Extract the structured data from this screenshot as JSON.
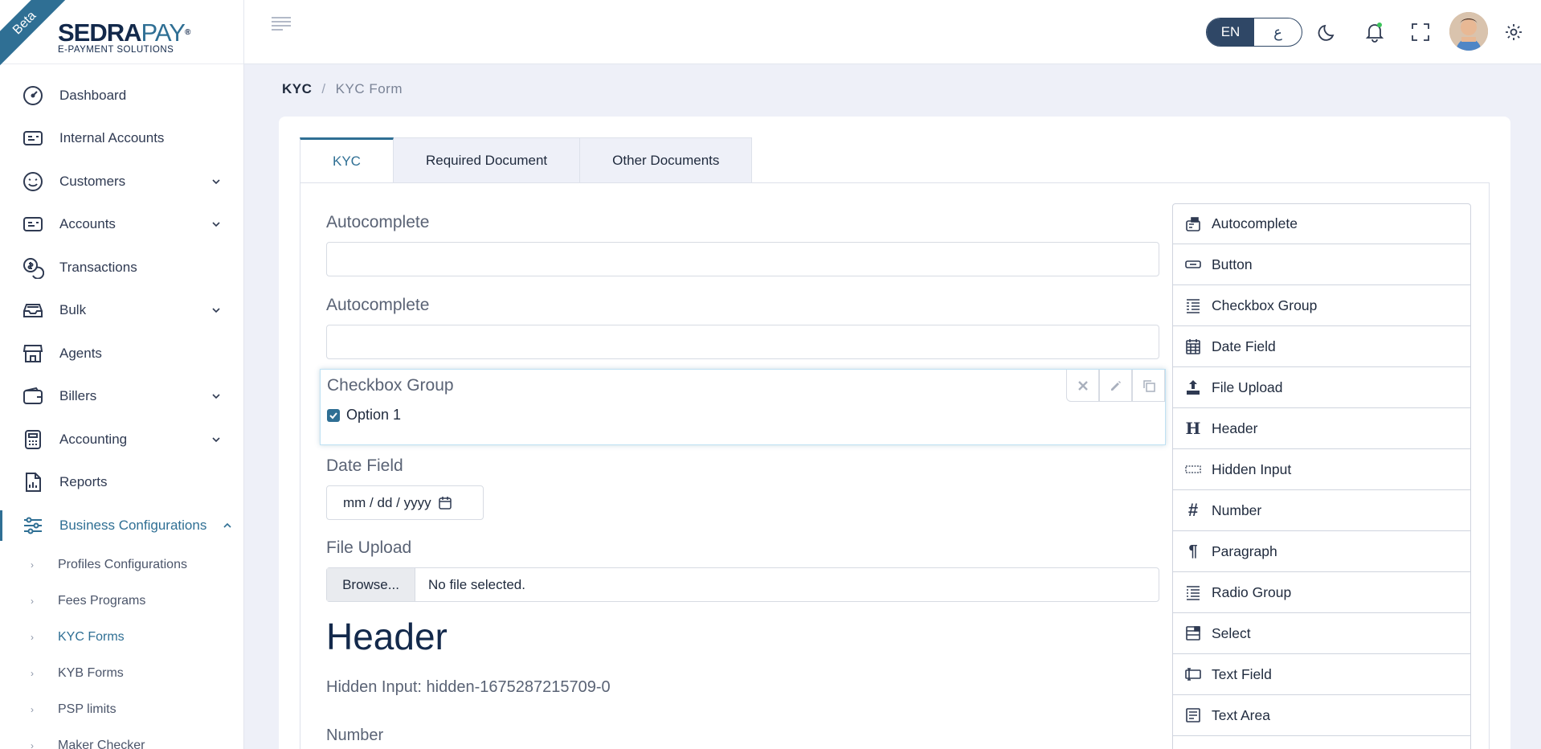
{
  "brand": {
    "beta": "Beta",
    "name_part1": "SEDRA",
    "name_part2": "PAY",
    "reg": "®",
    "tagline": "E-PAYMENT SOLUTIONS"
  },
  "sidebar": {
    "items": [
      {
        "label": "Dashboard",
        "icon": "speedometer-icon"
      },
      {
        "label": "Internal Accounts",
        "icon": "id-card-icon"
      },
      {
        "label": "Customers",
        "icon": "smiley-icon",
        "expandable": true
      },
      {
        "label": "Accounts",
        "icon": "id-card-icon",
        "expandable": true
      },
      {
        "label": "Transactions",
        "icon": "coins-icon"
      },
      {
        "label": "Bulk",
        "icon": "inbox-icon",
        "expandable": true
      },
      {
        "label": "Agents",
        "icon": "store-icon"
      },
      {
        "label": "Billers",
        "icon": "wallet-icon",
        "expandable": true
      },
      {
        "label": "Accounting",
        "icon": "calculator-icon",
        "expandable": true
      },
      {
        "label": "Reports",
        "icon": "report-icon"
      },
      {
        "label": "Business Configurations",
        "icon": "sliders-icon",
        "expanded": true
      }
    ],
    "sub_items": [
      {
        "label": "Profiles Configurations"
      },
      {
        "label": "Fees Programs"
      },
      {
        "label": "KYC Forms",
        "active": true
      },
      {
        "label": "KYB Forms"
      },
      {
        "label": "PSP limits"
      },
      {
        "label": "Maker Checker"
      }
    ]
  },
  "topbar": {
    "lang_active": "EN",
    "lang_other": "ع"
  },
  "breadcrumb": {
    "root": "KYC",
    "separator": "/",
    "current": "KYC Form"
  },
  "tabs": [
    {
      "label": "KYC",
      "active": true
    },
    {
      "label": "Required Document"
    },
    {
      "label": "Other Documents"
    }
  ],
  "form": {
    "autocomplete1_label": "Autocomplete",
    "autocomplete2_label": "Autocomplete",
    "checkbox_group_label": "Checkbox Group",
    "checkbox_option": "Option 1",
    "date_label": "Date Field",
    "date_placeholder": "mm / dd / yyyy",
    "file_label": "File Upload",
    "browse_label": "Browse...",
    "no_file": "No file selected.",
    "header_text": "Header",
    "hidden_input_text": "Hidden Input: hidden-1675287215709-0",
    "number_label": "Number"
  },
  "controls": [
    {
      "label": "Autocomplete",
      "icon": "autocomplete-icon"
    },
    {
      "label": "Button",
      "icon": "button-icon"
    },
    {
      "label": "Checkbox Group",
      "icon": "checklist-icon"
    },
    {
      "label": "Date Field",
      "icon": "calendar-icon"
    },
    {
      "label": "File Upload",
      "icon": "upload-icon"
    },
    {
      "label": "Header",
      "icon": "header-icon"
    },
    {
      "label": "Hidden Input",
      "icon": "hidden-input-icon"
    },
    {
      "label": "Number",
      "icon": "hash-icon"
    },
    {
      "label": "Paragraph",
      "icon": "paragraph-icon"
    },
    {
      "label": "Radio Group",
      "icon": "radio-list-icon"
    },
    {
      "label": "Select",
      "icon": "select-icon"
    },
    {
      "label": "Text Field",
      "icon": "text-field-icon"
    },
    {
      "label": "Text Area",
      "icon": "text-area-icon"
    }
  ],
  "colors": {
    "primary": "#2f6f94",
    "navy": "#13294b",
    "background": "#eef0f8"
  }
}
